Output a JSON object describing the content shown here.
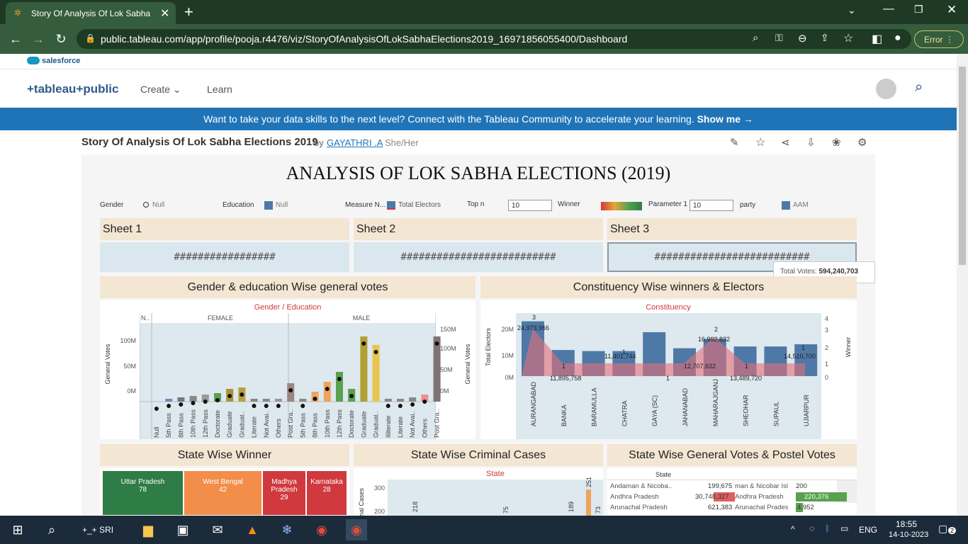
{
  "browser": {
    "tab_title": "Story Of Analysis Of Lok Sabha E",
    "url": "public.tableau.com/app/profile/pooja.r4476/viz/StoryOfAnalysisOfLokSabhaElections2019_16971856055400/Dashboard",
    "error_label": "Error"
  },
  "site": {
    "salesforce": "salesforce",
    "logo": "+tableau+public",
    "nav": [
      "Create",
      "Learn"
    ],
    "banner_text": "Want to take your data skills to the next level? Connect with the Tableau Community to accelerate your learning.",
    "banner_link": "Show me →"
  },
  "viz": {
    "title": "Story Of Analysis Of Lok Sabha Elections 2019",
    "by": "by",
    "author": "GAYATHRI .A",
    "pronoun": "She/Her"
  },
  "dashboard": {
    "title": "ANALYSIS OF LOK SABHA ELECTIONS (2019)",
    "filters": [
      {
        "label": "Gender",
        "value": "Null"
      },
      {
        "label": "Education",
        "value": "Null"
      },
      {
        "label": "Measure N...",
        "value": "Total Electors"
      },
      {
        "label": "Top n",
        "value": "10"
      },
      {
        "label": "Winner",
        "value": ""
      },
      {
        "label": "Parameter 1",
        "value": "10"
      },
      {
        "label": "party",
        "value": "AAM"
      }
    ],
    "sheets": [
      {
        "name": "Sheet 1",
        "hash": "#################"
      },
      {
        "name": "Sheet 2",
        "hash": "##########################"
      },
      {
        "name": "Sheet 3",
        "hash": "##########################"
      }
    ],
    "tooltip": {
      "label": "Total Votes:",
      "value": "594,240,703"
    },
    "panels": {
      "gender_edu": "Gender & education Wise general votes",
      "constituency": "Constituency Wise winners & Electors",
      "state_winner": "State Wise Winner",
      "criminal": "State Wise Criminal Cases",
      "postal": "State Wise General Votes & Postel Votes"
    },
    "gender_chart": {
      "header": "Gender / Education",
      "n_col": "N..",
      "groups": [
        "FEMALE",
        "MALE"
      ],
      "left_axis_title": "General Votes",
      "right_axis_title": "General Votes",
      "left_ticks": [
        "100M",
        "50M",
        "0M"
      ],
      "right_ticks": [
        "150M",
        "100M",
        "50M",
        "0M"
      ],
      "categories": [
        "Null",
        "5th Pass",
        "8th Pass",
        "10th Pass",
        "12th Pass",
        "Doctorate",
        "Graduate",
        "Graduat..",
        "Literate",
        "Not Avai..",
        "Others",
        "Post Gra..",
        "5th Pass",
        "8th Pass",
        "10th Pass",
        "12th Pass",
        "Doctorate",
        "Graduate",
        "Graduat..",
        "Illiterate",
        "Literate",
        "Not Avai..",
        "Others",
        "Post Gra.."
      ]
    },
    "constituency_chart": {
      "header": "Constituency",
      "left_axis_title": "Total Electors",
      "right_axis_title": "Winner",
      "left_ticks": [
        "20M",
        "10M",
        "0M"
      ],
      "right_ticks": [
        "4",
        "3",
        "2",
        "1",
        "0"
      ],
      "categories": [
        "AURANGABAD",
        "BANKA",
        "BARAMULLA",
        "CHATRA",
        "GAYA (SC)",
        "JAHANABAD",
        "MAHARAJGANJ",
        "SHEOHAR",
        "SUPAUL",
        "UJIARPUR"
      ],
      "labels": [
        "3",
        "24,973,966",
        "1",
        "11,895,758",
        "11,401,744",
        "1",
        "12,707,632",
        "1",
        "2",
        "16,992,832",
        "1",
        "13,489,720",
        "1",
        "14,510,700"
      ]
    },
    "state_winner": [
      {
        "state": "Uttar Pradesh",
        "value": "78",
        "color": "#2e7d46"
      },
      {
        "state": "West Bengal",
        "value": "42",
        "color": "#f28d4a"
      },
      {
        "state": "Madhya Pradesh",
        "value": "29",
        "color": "#d0393e"
      },
      {
        "state": "Karnataka",
        "value": "28",
        "color": "#d0393e"
      }
    ],
    "criminal": {
      "header": "State",
      "axis_title": "nal Cases",
      "ticks": [
        "300",
        "200"
      ],
      "labels": [
        "218",
        "75",
        "189",
        "251",
        "73"
      ]
    },
    "postal": {
      "header": "State",
      "rows": [
        {
          "state": "Andaman & Nicoba..",
          "general": "199,675",
          "state2": "man & Nicobar Isl",
          "postal": "200"
        },
        {
          "state": "Andhra Pradesh",
          "general": "30,748,327",
          "state2": "Andhra Pradesh",
          "postal": "220,376"
        },
        {
          "state": "Arunachal Pradesh",
          "general": "621,383",
          "state2": "Arunachal Prades",
          "postal": "4,952"
        }
      ]
    }
  },
  "taskbar": {
    "search": "+_+ SRI",
    "lang": "ENG",
    "time": "18:55",
    "date": "14-10-2023",
    "notif": "2"
  }
}
